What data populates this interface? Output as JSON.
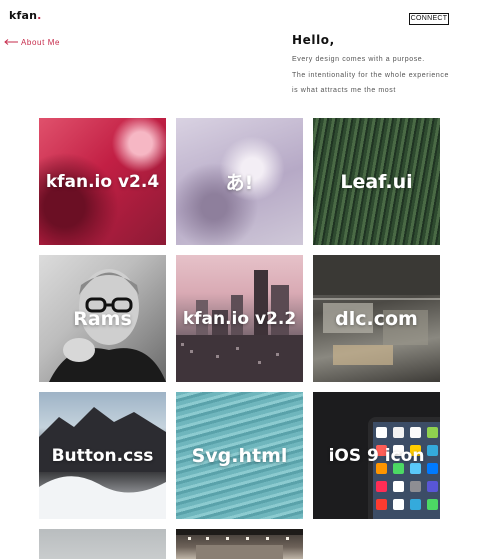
{
  "header": {
    "logo": "kfan",
    "logo_dot": ".",
    "connect_label": "CONNECT"
  },
  "nav": {
    "about_label": "About Me"
  },
  "intro": {
    "heading": "Hello,",
    "lines": [
      "Every design comes with a purpose.",
      "The intentionality for the whole experience",
      "is what attracts me the most"
    ]
  },
  "projects": [
    {
      "label": "kfan.io v2.4"
    },
    {
      "label": "あ!"
    },
    {
      "label": "Leaf.ui"
    },
    {
      "label": "Rams"
    },
    {
      "label": "kfan.io v2.2"
    },
    {
      "label": "dlc.com"
    },
    {
      "label": "Button.css"
    },
    {
      "label": "Svg.html"
    },
    {
      "label": "iOS 9 icon"
    },
    {
      "label": ""
    },
    {
      "label": ""
    }
  ],
  "colors": {
    "accent": "#c62b4b",
    "text": "#111111",
    "muted": "#555555"
  }
}
